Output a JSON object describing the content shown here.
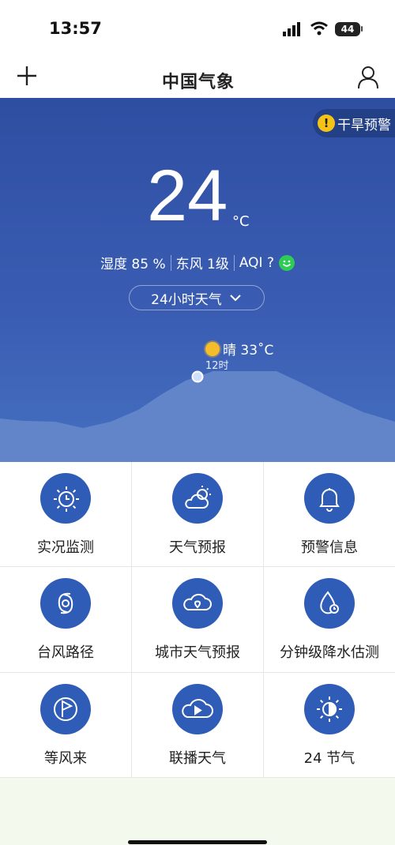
{
  "status_bar": {
    "time": "13:57",
    "battery": "44"
  },
  "header": {
    "logo": "中国气象"
  },
  "hero": {
    "alert": "干旱预警",
    "temperature": "24",
    "unit": "°C",
    "humidity": "湿度 85 %",
    "wind": "东风 1级",
    "aqi": "AQI ?",
    "toggle_label": "24小时天气",
    "forecast_text": "晴 33˚C",
    "forecast_hour": "12时"
  },
  "grid": {
    "items": [
      {
        "label": "实况监测",
        "icon": "sun-clock-icon"
      },
      {
        "label": "天气预报",
        "icon": "cloud-sun-icon"
      },
      {
        "label": "预警信息",
        "icon": "bell-icon"
      },
      {
        "label": "台风路径",
        "icon": "typhoon-icon"
      },
      {
        "label": "城市天气预报",
        "icon": "cloud-location-icon"
      },
      {
        "label": "分钟级降水估测",
        "icon": "drop-clock-icon"
      },
      {
        "label": "等风来",
        "icon": "pinwheel-icon"
      },
      {
        "label": "联播天气",
        "icon": "cloud-play-icon"
      },
      {
        "label": "24 节气",
        "icon": "half-sun-icon"
      }
    ]
  },
  "colors": {
    "hero_top": "#2e4ea2",
    "icon_circle": "#2e5cb7",
    "alert_icon": "#f3c317",
    "aqi_face": "#2ecc55"
  }
}
